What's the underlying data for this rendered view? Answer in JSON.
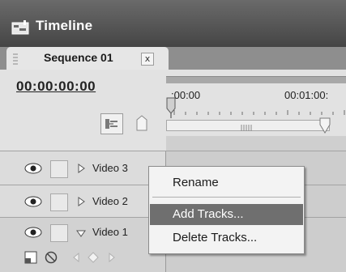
{
  "window": {
    "title": "Timeline",
    "icon": "timeline-icon"
  },
  "tab": {
    "label": "Sequence 01",
    "close_label": "x"
  },
  "timecode": "00:00:00:00",
  "ruler": {
    "ticks": [
      ":00:00",
      "00:01:00:"
    ]
  },
  "tracks": [
    {
      "name": "Video 3",
      "expanded": false
    },
    {
      "name": "Video 2",
      "expanded": false
    },
    {
      "name": "Video 1",
      "expanded": true
    }
  ],
  "context_menu": {
    "items": [
      "Rename",
      "Add Tracks...",
      "Delete Tracks..."
    ],
    "highlighted": "Add Tracks..."
  },
  "colors": {
    "titlebar": "#4f4f4f",
    "highlight": "#6f6f6f",
    "panel": "#e2e2e2"
  }
}
